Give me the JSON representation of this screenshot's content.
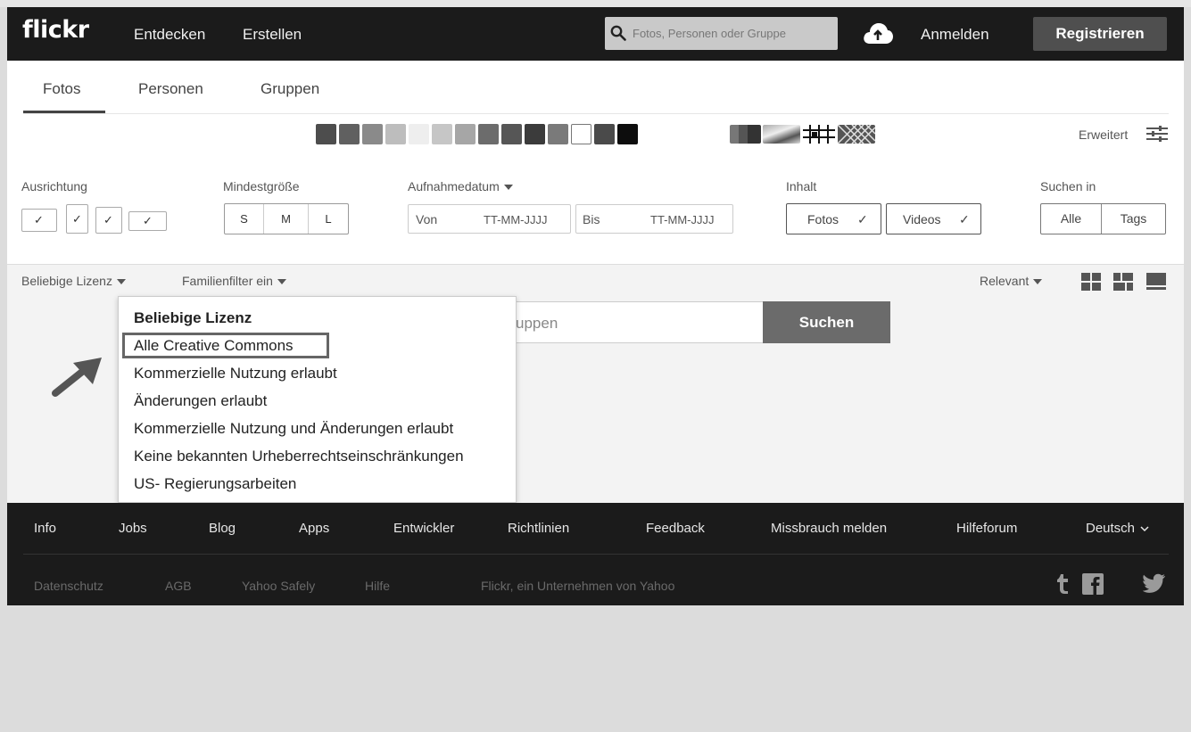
{
  "header": {
    "logo": "flickr",
    "nav": [
      "Entdecken",
      "Erstellen"
    ],
    "search_placeholder": "Fotos, Personen oder Gruppe",
    "login": "Anmelden",
    "register": "Registrieren"
  },
  "tabs": [
    "Fotos",
    "Personen",
    "Gruppen"
  ],
  "swatches": {
    "colors": [
      "#4d4d4d",
      "#606060",
      "#8a8a8a",
      "#bdbdbd",
      "#eeeeee",
      "#c6c6c6",
      "#a6a6a6",
      "#6c6c6c",
      "#565656",
      "#3b3b3b",
      "#7a7a7a",
      "#ffffff",
      "#4a4a4a",
      "#0d0d0d"
    ],
    "style_icons": [
      "grayscale-style-icon",
      "shallow-depth-style-icon",
      "minimalism-style-icon",
      "pattern-style-icon"
    ]
  },
  "advanced": {
    "label": "Erweitert",
    "icon": "sliders-icon"
  },
  "filters": {
    "orientation": {
      "label": "Ausrichtung",
      "icons": [
        "landscape-icon",
        "portrait-icon",
        "square-icon",
        "panorama-icon"
      ],
      "check": "✓"
    },
    "min_size": {
      "label": "Mindestgröße",
      "options": [
        "S",
        "M",
        "L"
      ]
    },
    "date": {
      "label": "Aufnahmedatum",
      "from_label": "Von",
      "from_placeholder": "TT-MM-JJJJ",
      "to_label": "Bis",
      "to_placeholder": "TT-MM-JJJJ"
    },
    "content": {
      "label": "Inhalt",
      "photos": "Fotos",
      "videos": "Videos",
      "check": "✓"
    },
    "search_in": {
      "label": "Suchen in",
      "all": "Alle",
      "tags": "Tags"
    }
  },
  "results_bar": {
    "license": "Beliebige Lizenz",
    "family": "Familienfilter ein",
    "sort": "Relevant",
    "view_icons": [
      "grid-view-icon",
      "justified-view-icon",
      "list-view-icon"
    ]
  },
  "main_search": {
    "placeholder_visible": "uppen",
    "button": "Suchen"
  },
  "license_dropdown": {
    "items": [
      "Beliebige Lizenz",
      "Alle Creative Commons",
      "Kommerzielle Nutzung erlaubt",
      "Änderungen erlaubt",
      "Kommerzielle Nutzung und Änderungen erlaubt",
      "Keine bekannten Urheberrechtseinschränkungen",
      "US- Regierungsarbeiten"
    ],
    "highlighted": "Alle Creative Commons"
  },
  "footer": {
    "links": [
      "Info",
      "Jobs",
      "Blog",
      "Apps",
      "Entwickler",
      "Richtlinien",
      "Feedback",
      "Missbrauch melden",
      "Hilfeforum"
    ],
    "language": "Deutsch",
    "sub_links": [
      "Datenschutz",
      "AGB",
      "Yahoo Safely",
      "Hilfe",
      "Flickr, ein Unternehmen von Yahoo"
    ],
    "social_icons": [
      "tumblr-icon",
      "facebook-icon",
      "twitter-icon"
    ]
  }
}
